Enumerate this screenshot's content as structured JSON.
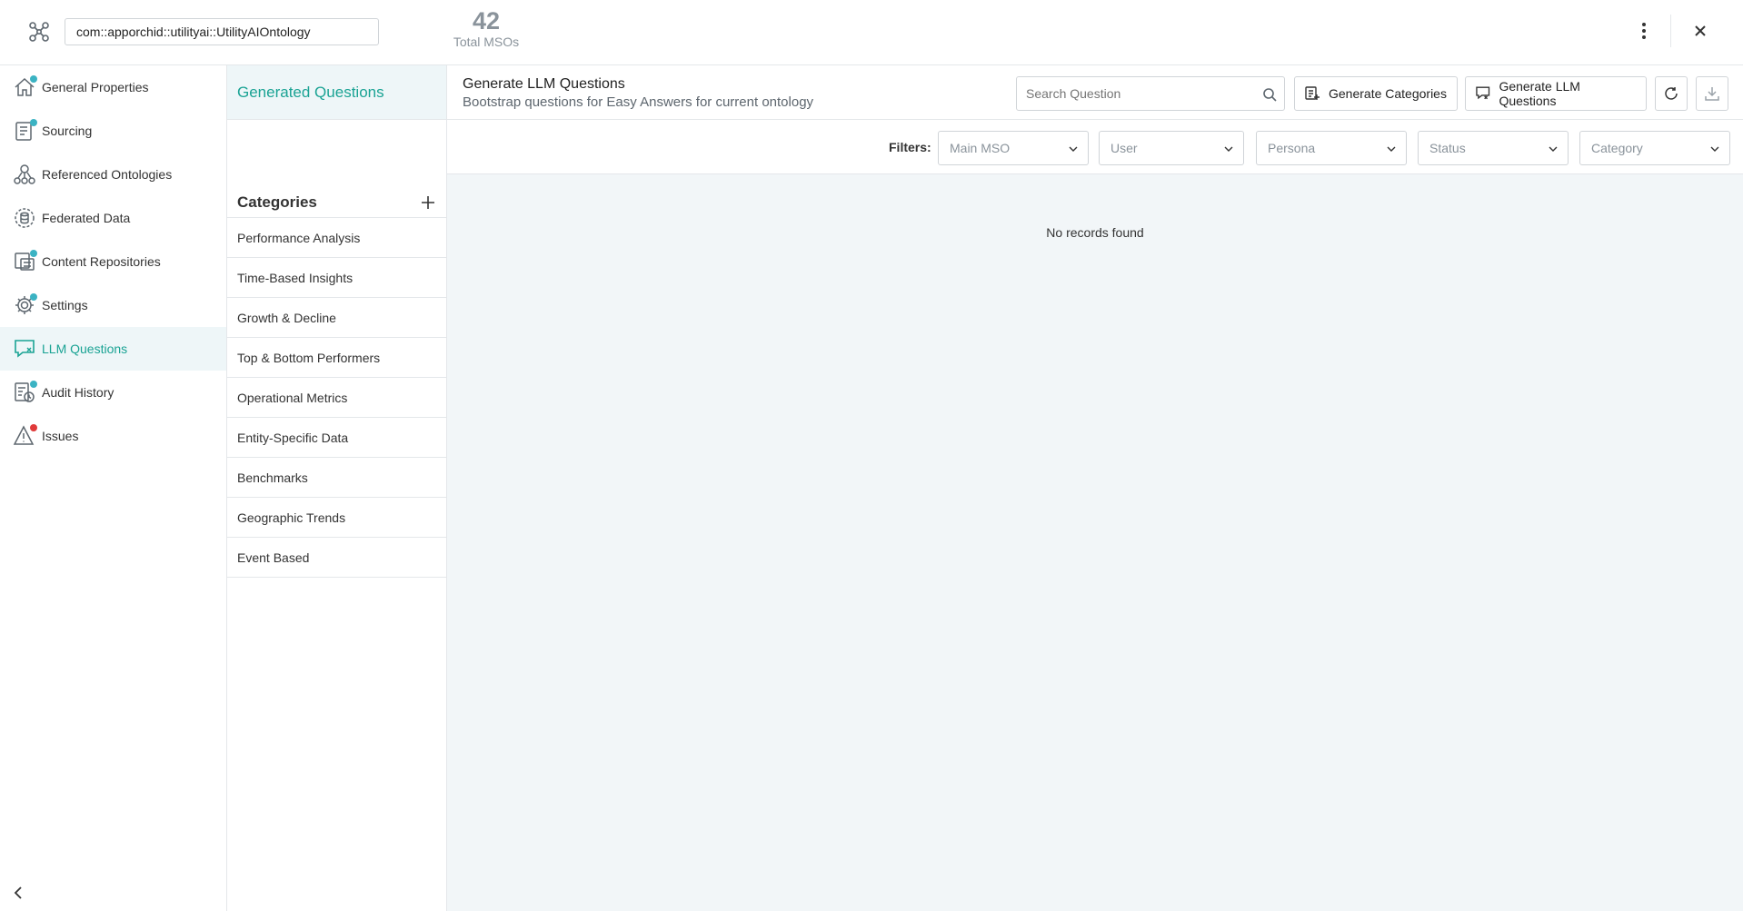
{
  "header": {
    "ontology_path": "com::apporchid::utilityai::UtilityAIOntology",
    "total_count": "42",
    "total_label": "Total MSOs"
  },
  "nav": {
    "items": [
      {
        "label": "General Properties",
        "icon": "home-icon",
        "dot": "#3bb3c3"
      },
      {
        "label": "Sourcing",
        "icon": "sourcing-icon",
        "dot": "#3bb3c3"
      },
      {
        "label": "Referenced Ontologies",
        "icon": "ontology-tree-icon",
        "dot": ""
      },
      {
        "label": "Federated Data",
        "icon": "federated-data-icon",
        "dot": ""
      },
      {
        "label": "Content Repositories",
        "icon": "content-repository-icon",
        "dot": "#3bb3c3"
      },
      {
        "label": "Settings",
        "icon": "gear-icon",
        "dot": "#3bb3c3"
      },
      {
        "label": "LLM Questions",
        "icon": "chat-question-icon",
        "dot": ""
      },
      {
        "label": "Audit History",
        "icon": "audit-history-icon",
        "dot": "#3bb3c3"
      },
      {
        "label": "Issues",
        "icon": "warning-icon",
        "dot": "#e03a3a"
      }
    ],
    "active_index": 6
  },
  "middle": {
    "tab_label": "Generated Questions",
    "categories_title": "Categories",
    "categories": [
      "Performance Analysis",
      "Time-Based Insights",
      "Growth & Decline",
      "Top & Bottom Performers",
      "Operational Metrics",
      "Entity-Specific Data",
      "Benchmarks",
      "Geographic Trends",
      "Event Based"
    ]
  },
  "main": {
    "title": "Generate LLM Questions",
    "subtitle": "Bootstrap questions for Easy Answers for current ontology",
    "search_placeholder": "Search Question",
    "generate_categories_label": "Generate Categories",
    "generate_llm_label": "Generate LLM Questions",
    "filters_label": "Filters:",
    "filters": {
      "main_mso": "Main MSO",
      "user": "User",
      "persona": "Persona",
      "status": "Status",
      "category": "Category"
    },
    "empty_text": "No records found"
  },
  "colors": {
    "accent": "#1aa394",
    "active_bg": "#eef6f8",
    "main_bg": "#f2f6f8"
  }
}
